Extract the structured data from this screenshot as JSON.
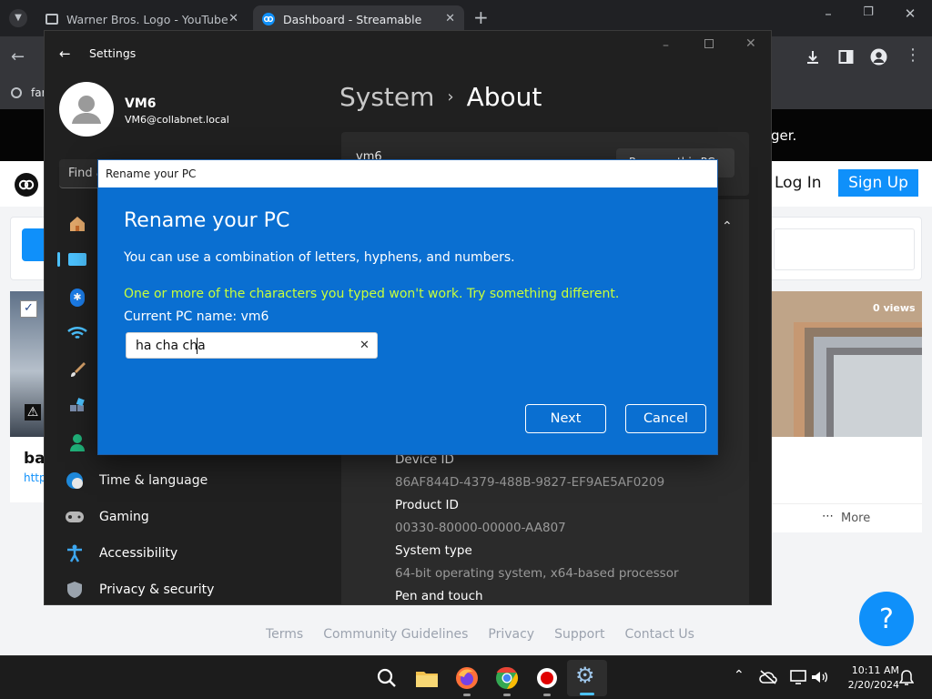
{
  "browser": {
    "tabs": [
      {
        "title": "Warner Bros. Logo - YouTube"
      },
      {
        "title": "Dashboard - Streamable"
      }
    ],
    "bookmark_partial": "far"
  },
  "streamable": {
    "banner_partial": "ger.",
    "login_label": "Log In",
    "signup_label": "Sign Up",
    "card_title_partial": "ba",
    "card_link_partial": "http",
    "views": "0 views",
    "more_label": "More",
    "footer_links": [
      "Terms",
      "Community Guidelines",
      "Privacy",
      "Support",
      "Contact Us"
    ],
    "help_label": "?"
  },
  "settings": {
    "window_title": "Settings",
    "user_name": "VM6",
    "user_email": "VM6@collabnet.local",
    "search_partial": "Find a",
    "breadcrumb_parent": "System",
    "breadcrumb_current": "About",
    "device_name": "vm6",
    "rename_btn_partial": "Rename this PC",
    "nav": [
      {
        "label": "Time & language"
      },
      {
        "label": "Gaming"
      },
      {
        "label": "Accessibility"
      },
      {
        "label": "Privacy & security"
      }
    ],
    "specs": [
      {
        "label": "Device ID",
        "value": "86AF844D-4379-488B-9827-EF9AE5AF0209"
      },
      {
        "label": "Product ID",
        "value": "00330-80000-00000-AA807"
      },
      {
        "label": "System type",
        "value": "64-bit operating system, x64-based processor"
      },
      {
        "label": "Pen and touch",
        "value": ""
      }
    ]
  },
  "dialog": {
    "titlebar": "Rename your PC",
    "heading": "Rename your PC",
    "description": "You can use a combination of letters, hyphens, and numbers.",
    "error": "One or more of the characters you typed won't work. Try something different.",
    "current_name": "Current PC name: vm6",
    "input_value": "ha cha cha",
    "next_label": "Next",
    "cancel_label": "Cancel"
  },
  "taskbar": {
    "time": "10:11 AM",
    "date": "2/20/2024"
  },
  "colors": {
    "dialog_blue": "#0a6fd1",
    "error_text": "#c8ff3a",
    "streamable_blue": "#0f90fa"
  }
}
